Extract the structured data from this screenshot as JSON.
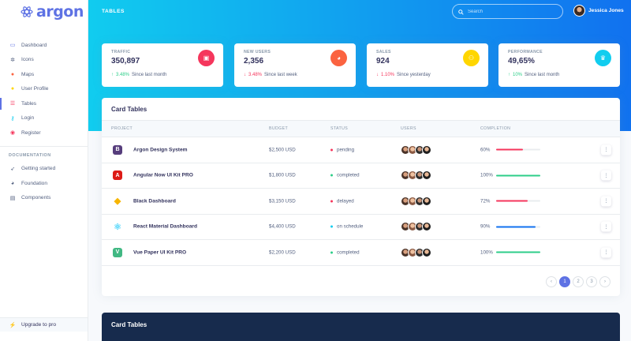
{
  "brand": {
    "name": "argon",
    "accent": "#5e72e4"
  },
  "sidebar": {
    "items": [
      {
        "label": "Dashboard",
        "icon": "tv-icon",
        "color": "#5e72e4"
      },
      {
        "label": "Icons",
        "icon": "planet-icon",
        "color": "#525f7f"
      },
      {
        "label": "Maps",
        "icon": "pin-icon",
        "color": "#fb6340"
      },
      {
        "label": "User Profile",
        "icon": "user-icon",
        "color": "#ffd600"
      },
      {
        "label": "Tables",
        "icon": "list-icon",
        "color": "#f5365c"
      },
      {
        "label": "Login",
        "icon": "key-icon",
        "color": "#11cdef"
      },
      {
        "label": "Register",
        "icon": "circle-user-icon",
        "color": "#f5365c"
      }
    ],
    "section_label": "DOCUMENTATION",
    "doc_items": [
      {
        "label": "Getting started",
        "icon": "spaceship-icon"
      },
      {
        "label": "Foundation",
        "icon": "palette-icon"
      },
      {
        "label": "Components",
        "icon": "ui-icon"
      }
    ],
    "upgrade_label": "Upgrade to pro"
  },
  "header": {
    "title": "TABLES",
    "search_placeholder": "Search",
    "user_name": "Jessica Jones"
  },
  "stats": [
    {
      "label": "TRAFFIC",
      "value": "350,897",
      "delta": "3.48%",
      "direction": "up",
      "note": "Since last month",
      "icon_color": "#f5365c",
      "icon": "chart-icon"
    },
    {
      "label": "NEW USERS",
      "value": "2,356",
      "delta": "3.48%",
      "direction": "down",
      "note": "Since last week",
      "icon_color": "#fb6340",
      "icon": "pie-chart-icon"
    },
    {
      "label": "SALES",
      "value": "924",
      "delta": "1.10%",
      "direction": "down",
      "note": "Since yesterday",
      "icon_color": "#ffd600",
      "icon": "users-icon"
    },
    {
      "label": "PERFORMANCE",
      "value": "49,65%",
      "delta": "10%",
      "direction": "up",
      "note": "Since last month",
      "icon_color": "#11cdef",
      "icon": "trophy-icon"
    }
  ],
  "table": {
    "title": "Card Tables",
    "columns": [
      "PROJECT",
      "BUDGET",
      "STATUS",
      "USERS",
      "COMPLETION"
    ],
    "rows": [
      {
        "project": "Argon Design System",
        "logo": "bootstrap-icon",
        "logo_color": "#563d7c",
        "logo_char": "B",
        "budget": "$2,500 USD",
        "status": "pending",
        "status_color": "#f5365c",
        "completion_label": "60%",
        "completion": 0.6,
        "bar_color": "#f5365c"
      },
      {
        "project": "Angular Now UI Kit PRO",
        "logo": "angular-icon",
        "logo_color": "#dd1b16",
        "logo_char": "A",
        "budget": "$1,800 USD",
        "status": "completed",
        "status_color": "#2dce89",
        "completion_label": "100%",
        "completion": 1.0,
        "bar_color": "#2dce89"
      },
      {
        "project": "Black Dashboard",
        "logo": "sketch-icon",
        "logo_color": "#f7b500",
        "logo_char": "◆",
        "budget": "$3,150 USD",
        "status": "delayed",
        "status_color": "#f5365c",
        "completion_label": "72%",
        "completion": 0.72,
        "bar_color": "#f5365c"
      },
      {
        "project": "React Material Dashboard",
        "logo": "react-icon",
        "logo_color": "#61dafb",
        "logo_char": "⚛",
        "budget": "$4,400 USD",
        "status": "on schedule",
        "status_color": "#11cdef",
        "completion_label": "90%",
        "completion": 0.9,
        "bar_color": "#1171ef"
      },
      {
        "project": "Vue Paper UI Kit PRO",
        "logo": "vue-icon",
        "logo_color": "#41b883",
        "logo_char": "V",
        "budget": "$2,200 USD",
        "status": "completed",
        "status_color": "#2dce89",
        "completion_label": "100%",
        "completion": 1.0,
        "bar_color": "#2dce89"
      }
    ],
    "pagination": {
      "prev": "‹",
      "pages": [
        "1",
        "2",
        "3"
      ],
      "active": "1",
      "next": "›"
    }
  },
  "dark_card": {
    "title": "Card Tables"
  }
}
